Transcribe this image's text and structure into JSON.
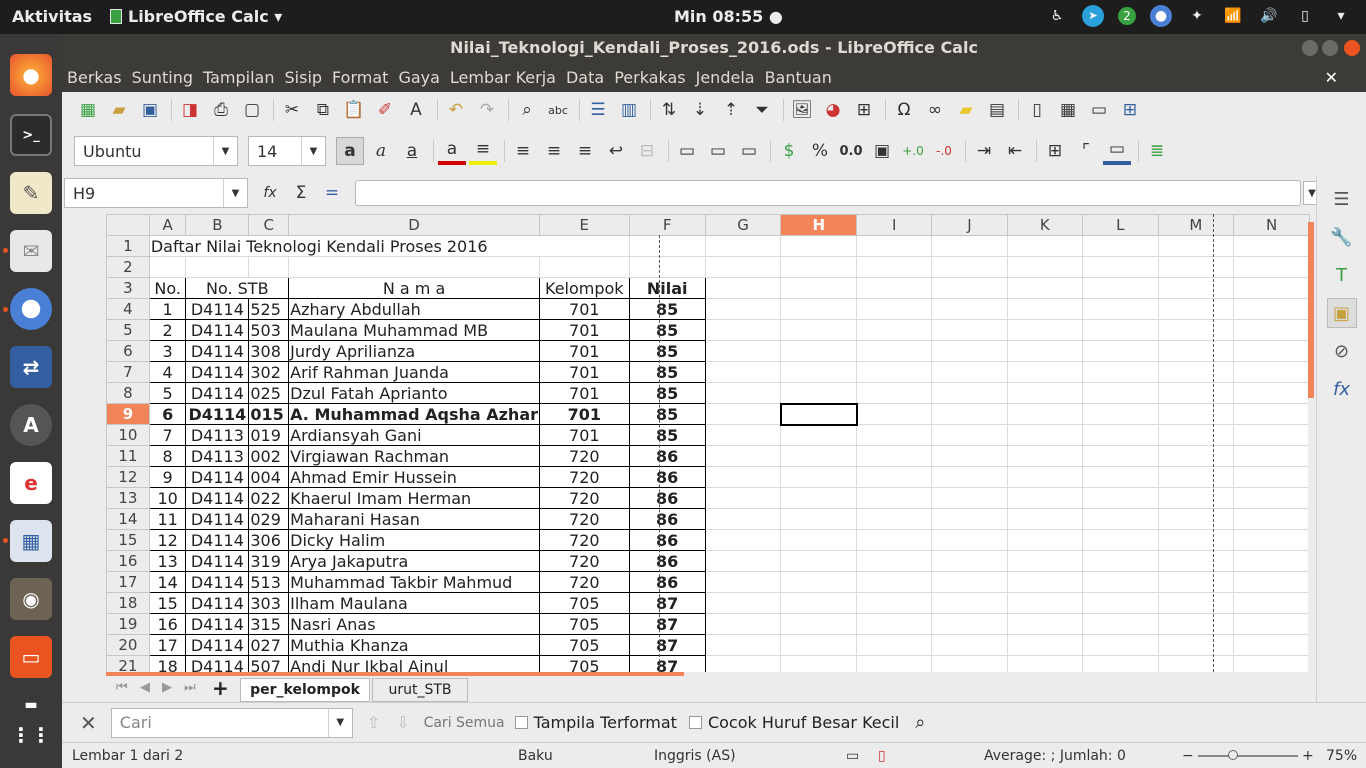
{
  "topbar": {
    "activities": "Aktivitas",
    "app": "LibreOffice Calc ▾",
    "clock": "Min 08:55 ●",
    "badge": "2"
  },
  "window": {
    "title": "Nilai_Teknologi_Kendali_Proses_2016.ods - LibreOffice Calc"
  },
  "menu": [
    "Berkas",
    "Sunting",
    "Tampilan",
    "Sisip",
    "Format",
    "Gaya",
    "Lembar Kerja",
    "Data",
    "Perkakas",
    "Jendela",
    "Bantuan"
  ],
  "font": {
    "name": "Ubuntu",
    "size": "14"
  },
  "formula": {
    "cell_ref": "H9",
    "value": ""
  },
  "columns": [
    "A",
    "B",
    "C",
    "D",
    "E",
    "F",
    "G",
    "H",
    "I",
    "J",
    "K",
    "L",
    "M",
    "N"
  ],
  "selected_cell": {
    "col": "H",
    "row": "9"
  },
  "sheet": {
    "title": "Daftar Nilai Teknologi Kendali Proses 2016",
    "headers": {
      "no": "No.",
      "stb": "No. STB",
      "nama": "N a m a",
      "kelompok": "Kelompok",
      "nilai": "Nilai"
    },
    "rows": [
      {
        "r": "4",
        "no": "1",
        "stb1": "D4114",
        "stb2": "525",
        "nama": "Azhary Abdullah",
        "kel": "701",
        "nilai": "85"
      },
      {
        "r": "5",
        "no": "2",
        "stb1": "D4114",
        "stb2": "503",
        "nama": "Maulana Muhammad MB",
        "kel": "701",
        "nilai": "85"
      },
      {
        "r": "6",
        "no": "3",
        "stb1": "D4114",
        "stb2": "308",
        "nama": "Jurdy Aprilianza",
        "kel": "701",
        "nilai": "85"
      },
      {
        "r": "7",
        "no": "4",
        "stb1": "D4114",
        "stb2": "302",
        "nama": "Arif Rahman Juanda",
        "kel": "701",
        "nilai": "85"
      },
      {
        "r": "8",
        "no": "5",
        "stb1": "D4114",
        "stb2": "025",
        "nama": "Dzul Fatah Aprianto",
        "kel": "701",
        "nilai": "85"
      },
      {
        "r": "9",
        "no": "6",
        "stb1": "D4114",
        "stb2": "015",
        "nama": "A. Muhammad Aqsha Azhar",
        "kel": "701",
        "nilai": "85",
        "bold": true
      },
      {
        "r": "10",
        "no": "7",
        "stb1": "D4113",
        "stb2": "019",
        "nama": "Ardiansyah Gani",
        "kel": "701",
        "nilai": "85"
      },
      {
        "r": "11",
        "no": "8",
        "stb1": "D4113",
        "stb2": "002",
        "nama": "Virgiawan Rachman",
        "kel": "720",
        "nilai": "86"
      },
      {
        "r": "12",
        "no": "9",
        "stb1": "D4114",
        "stb2": "004",
        "nama": "Ahmad Emir Hussein",
        "kel": "720",
        "nilai": "86"
      },
      {
        "r": "13",
        "no": "10",
        "stb1": "D4114",
        "stb2": "022",
        "nama": "Khaerul Imam Herman",
        "kel": "720",
        "nilai": "86"
      },
      {
        "r": "14",
        "no": "11",
        "stb1": "D4114",
        "stb2": "029",
        "nama": "Maharani Hasan",
        "kel": "720",
        "nilai": "86"
      },
      {
        "r": "15",
        "no": "12",
        "stb1": "D4114",
        "stb2": "306",
        "nama": "Dicky Halim",
        "kel": "720",
        "nilai": "86"
      },
      {
        "r": "16",
        "no": "13",
        "stb1": "D4114",
        "stb2": "319",
        "nama": "Arya Jakaputra",
        "kel": "720",
        "nilai": "86"
      },
      {
        "r": "17",
        "no": "14",
        "stb1": "D4114",
        "stb2": "513",
        "nama": "Muhammad Takbir Mahmud",
        "kel": "720",
        "nilai": "86"
      },
      {
        "r": "18",
        "no": "15",
        "stb1": "D4114",
        "stb2": "303",
        "nama": "Ilham Maulana",
        "kel": "705",
        "nilai": "87"
      },
      {
        "r": "19",
        "no": "16",
        "stb1": "D4114",
        "stb2": "315",
        "nama": "Nasri Anas",
        "kel": "705",
        "nilai": "87"
      },
      {
        "r": "20",
        "no": "17",
        "stb1": "D4114",
        "stb2": "027",
        "nama": "Muthia Khanza",
        "kel": "705",
        "nilai": "87"
      },
      {
        "r": "21",
        "no": "18",
        "stb1": "D4114",
        "stb2": "507",
        "nama": "Andi Nur Ikbal Ainul",
        "kel": "705",
        "nilai": "87"
      }
    ]
  },
  "tabs": {
    "active": "per_kelompok",
    "other": "urut_STB",
    "add": "+"
  },
  "find": {
    "placeholder": "Cari",
    "find_all": "Cari Semua",
    "formatted": "Tampila Terformat",
    "match_case": "Cocok Huruf Besar Kecil"
  },
  "status": {
    "sheet": "Lembar 1 dari 2",
    "style": "Baku",
    "lang": "Inggris (AS)",
    "sum": "Average: ; Jumlah: 0",
    "zoom": "75%"
  },
  "colors": {
    "accent": "#f3845a",
    "titlebar": "#3c3b37",
    "dock": "#3b3838"
  }
}
